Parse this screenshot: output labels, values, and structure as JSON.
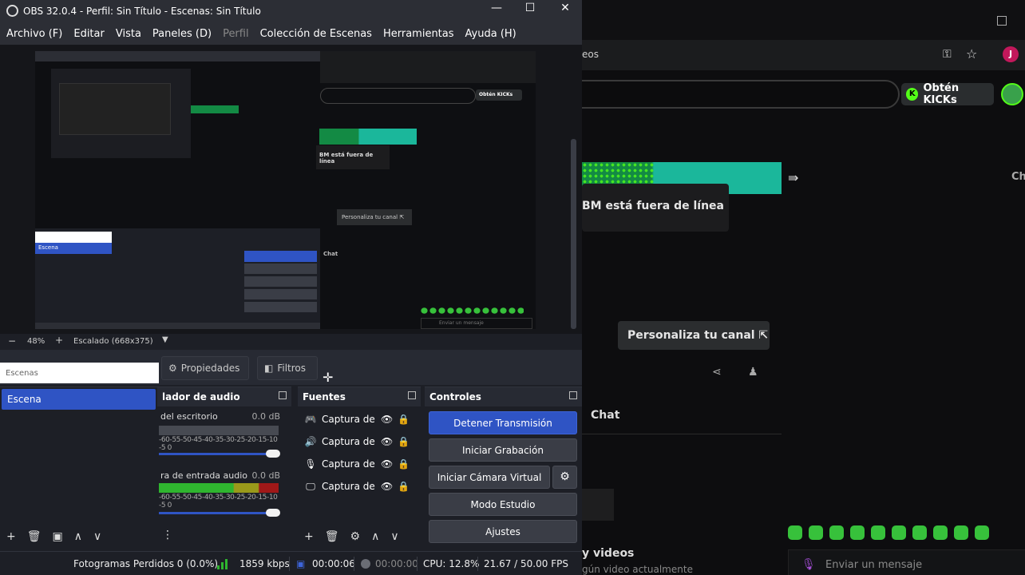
{
  "window": {
    "title": "OBS 32.0.4 - Perfil: Sin Título - Escenas: Sin Título",
    "minimize": "—",
    "maximize": "☐",
    "close": "✕"
  },
  "menu": [
    "Archivo (F)",
    "Editar",
    "Vista",
    "Paneles (D)",
    "Perfil",
    "Colección de Escenas",
    "Herramientas",
    "Ayuda (H)"
  ],
  "zoombar": {
    "minus": "−",
    "zoom": "48%",
    "plus": "+",
    "mode": "Escalado (668x375)",
    "dropdown": "▼"
  },
  "context": {
    "filter_placeholder": "Escenas",
    "properties": "Propiedades",
    "filters": "Filtros"
  },
  "scenes": {
    "items": [
      "Escena"
    ],
    "toolbar": [
      "+",
      "🗑",
      "▣",
      "∧",
      "∨"
    ]
  },
  "mixer": {
    "title": "lador de audio",
    "scale": "-60-55-50-45-40-35-30-25-20-15-10 -5 0",
    "channels": [
      {
        "name": "del escritorio",
        "db": "0.0 dB"
      },
      {
        "name": "ra de entrada audio",
        "db": "0.0 dB"
      }
    ],
    "more": "⋮"
  },
  "sources": {
    "title": "Fuentes",
    "items": [
      {
        "name": "Captura de juego",
        "icon": "gamepad-icon"
      },
      {
        "name": "Captura de salida de audio",
        "icon": "speaker-icon"
      },
      {
        "name": "Captura de entrada de audio",
        "icon": "mic-icon"
      },
      {
        "name": "Captura de pantalla",
        "icon": "monitor-icon"
      }
    ],
    "toolbar": [
      "+",
      "🗑",
      "⚙",
      "∧",
      "∨"
    ]
  },
  "controls": {
    "title": "Controles",
    "stream": "Detener Transmisión",
    "record": "Iniciar Grabación",
    "vcam": "Iniciar Cámara Virtual",
    "studio": "Modo Estudio",
    "settings": "Ajustes",
    "gear": "⚙"
  },
  "status": {
    "dropped": "Fotogramas Perdidos 0 (0.0%)",
    "kbps": "1859 kbps",
    "stream_time": "00:00:06",
    "rec_time": "00:00:00",
    "cpu": "CPU: 12.8%",
    "fps": "21.67 / 50.00 FPS"
  },
  "browser": {
    "url_fragment": "eos",
    "avatar": "J",
    "kick_button": "Obtén KICKs",
    "kick_letter": "K",
    "channel_partial": "Ch",
    "offline": "BM está fuera de línea",
    "personaliza": "Personaliza tu canal ⇱",
    "chat": "Chat",
    "videos": "y videos",
    "videos_sub": "gún video actualmente",
    "message": "Enviar un mensaje"
  },
  "colors": {
    "accent": "#2f54c4",
    "kick_green": "#53fc18",
    "meter_green": "#2fb52f",
    "meter_yellow": "#9a9a1a",
    "meter_red": "#a01818"
  },
  "levels": {
    "desktop_fill": 1.0,
    "mic_fill": 1.0
  }
}
